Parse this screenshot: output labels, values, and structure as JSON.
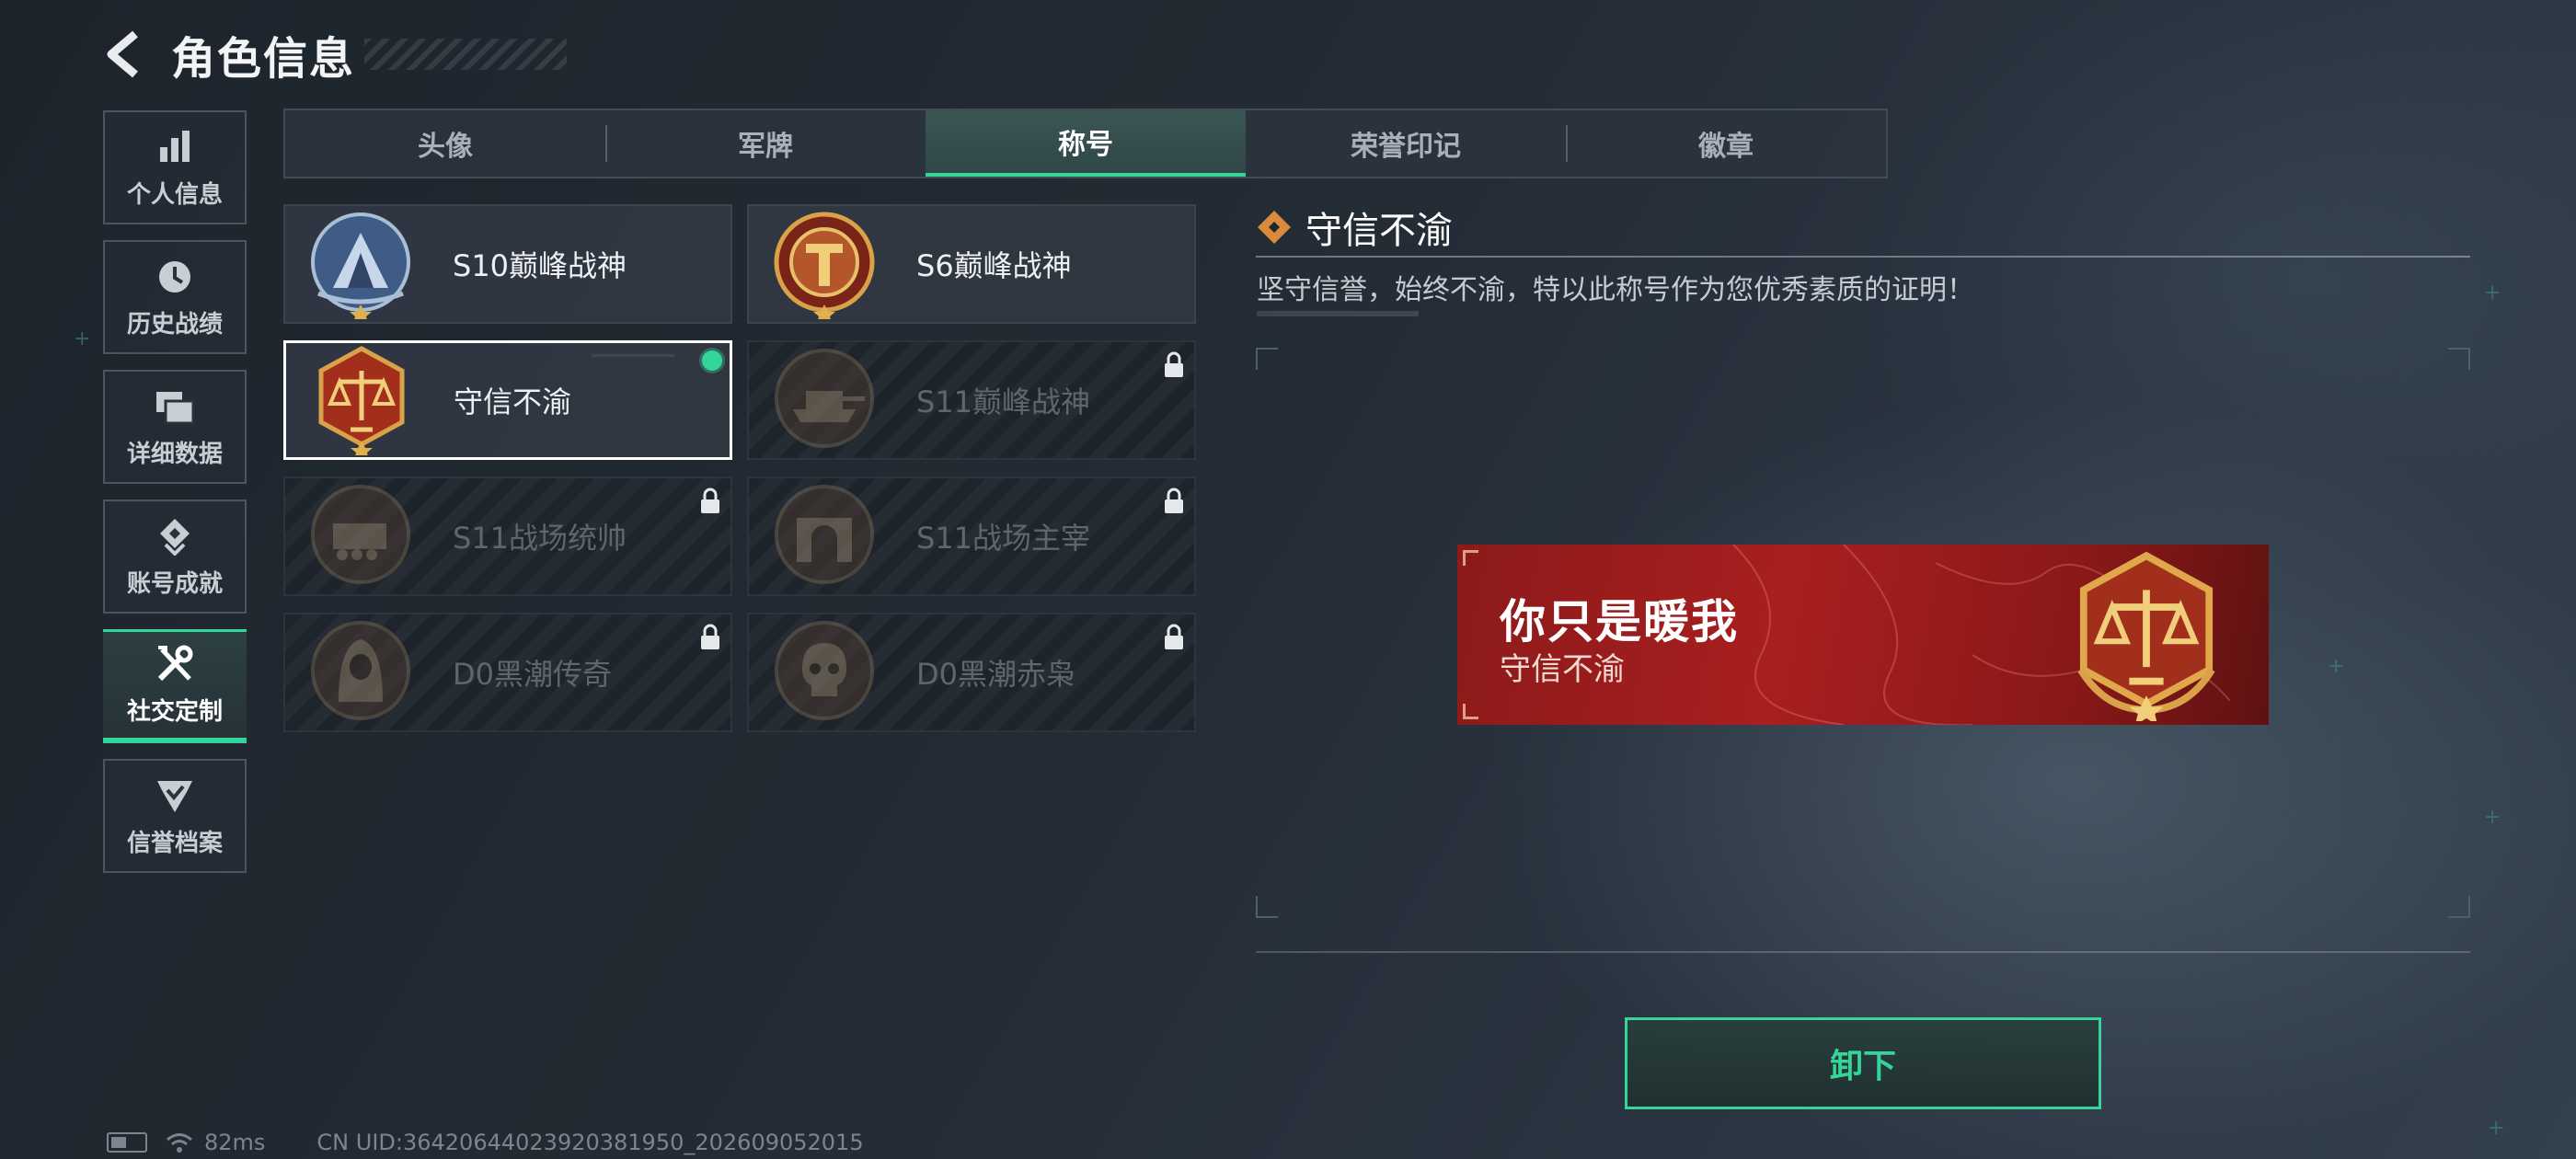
{
  "header": {
    "title": "角色信息",
    "back_icon": "back-arrow-icon"
  },
  "sidebar": {
    "items": [
      {
        "label": "个人信息",
        "icon": "bar-chart-icon",
        "active": false
      },
      {
        "label": "历史战绩",
        "icon": "clock-icon",
        "active": false
      },
      {
        "label": "详细数据",
        "icon": "folders-icon",
        "active": false
      },
      {
        "label": "账号成就",
        "icon": "diamond-badge-icon",
        "active": false
      },
      {
        "label": "社交定制",
        "icon": "tools-icon",
        "active": true
      },
      {
        "label": "信誉档案",
        "icon": "shield-check-icon",
        "active": false
      }
    ]
  },
  "tabs": [
    {
      "label": "头像",
      "active": false
    },
    {
      "label": "军牌",
      "active": false
    },
    {
      "label": "称号",
      "active": true
    },
    {
      "label": "荣誉印记",
      "active": false
    },
    {
      "label": "徽章",
      "active": false
    }
  ],
  "titles": [
    {
      "name": "S10巅峰战神",
      "locked": false,
      "selected": false,
      "equipped": false
    },
    {
      "name": "S6巅峰战神",
      "locked": false,
      "selected": false,
      "equipped": false
    },
    {
      "name": "守信不渝",
      "locked": false,
      "selected": true,
      "equipped": true
    },
    {
      "name": "S11巅峰战神",
      "locked": true,
      "selected": false,
      "equipped": false
    },
    {
      "name": "S11战场统帅",
      "locked": true,
      "selected": false,
      "equipped": false
    },
    {
      "name": "S11战场主宰",
      "locked": true,
      "selected": false,
      "equipped": false
    },
    {
      "name": "D0黑潮传奇",
      "locked": true,
      "selected": false,
      "equipped": false
    },
    {
      "name": "D0黑潮赤枭",
      "locked": true,
      "selected": false,
      "equipped": false
    }
  ],
  "detail": {
    "name": "守信不渝",
    "description": "坚守信誉，始终不渝，特以此称号作为您优秀素质的证明！",
    "banner": {
      "player_name": "你只是暖我",
      "title": "守信不渝"
    },
    "action_label": "卸下"
  },
  "status_bar": {
    "ping": "82ms",
    "uid": "CN UID:3642064402392038195​0_202609052015"
  },
  "colors": {
    "accent": "#35d59a",
    "banner_red": "#a81f1f",
    "emblem_gold": "#d9a24a"
  }
}
